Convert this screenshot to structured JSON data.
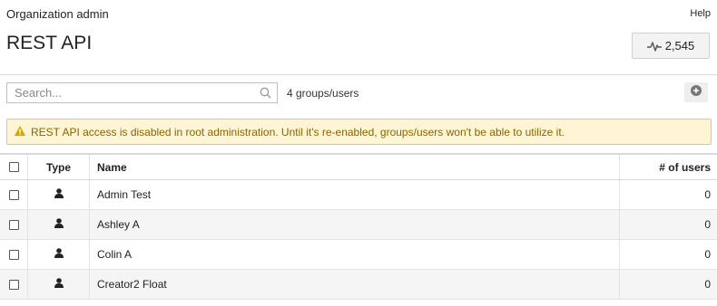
{
  "header": {
    "breadcrumb": "Organization admin",
    "help_label": "Help",
    "page_title": "REST API",
    "activity_count": "2,545"
  },
  "toolbar": {
    "search_placeholder": "Search...",
    "count_label": "4 groups/users"
  },
  "warning": {
    "message": "REST API access is disabled in root administration. Until it's re-enabled, groups/users won't be able to utilize it."
  },
  "table": {
    "columns": {
      "type": "Type",
      "name": "Name",
      "num_users": "# of users"
    },
    "rows": [
      {
        "type_icon": "user-icon",
        "name": "Admin Test",
        "num_users": "0"
      },
      {
        "type_icon": "user-icon",
        "name": "Ashley A",
        "num_users": "0"
      },
      {
        "type_icon": "user-icon",
        "name": "Colin A",
        "num_users": "0"
      },
      {
        "type_icon": "user-icon",
        "name": "Creator2 Float",
        "num_users": "0"
      }
    ]
  },
  "colors": {
    "warning_bg": "#fdf5d3",
    "warning_border": "#e4c96c",
    "warning_text": "#8a6500",
    "warning_icon": "#d9a400"
  }
}
